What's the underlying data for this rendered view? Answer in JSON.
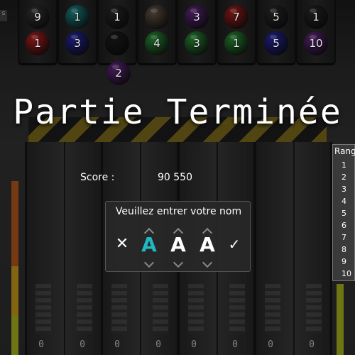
{
  "game": {
    "title": "Partie Terminée",
    "score_label": "Score :",
    "score_value": "90 550",
    "name_prompt": "Veuillez entrer votre nom",
    "name_letters": [
      "A",
      "A",
      "A"
    ],
    "active_letter_index": 0,
    "cancel_symbol": "✕",
    "confirm_symbol": "✓"
  },
  "rank_panel": {
    "header": "Rang",
    "ranks": [
      "1",
      "2",
      "3",
      "4",
      "5",
      "6",
      "7",
      "8",
      "9",
      "10"
    ]
  },
  "tubes": [
    {
      "balls": [
        {
          "label": "9",
          "color": "#3a3a3a"
        },
        {
          "label": "1",
          "color": "#c42222"
        }
      ]
    },
    {
      "balls": [
        {
          "label": "1",
          "color": "#1f8f8f"
        },
        {
          "label": "3",
          "color": "#2a2ab0"
        }
      ]
    },
    {
      "balls": [
        {
          "label": "1",
          "color": "#2b2b2b"
        },
        {
          "label": "",
          "color": "#1e1e1e"
        }
      ]
    },
    {
      "balls": [
        {
          "label": "",
          "color": "#6b5b4b"
        },
        {
          "label": "4",
          "color": "#2e9a3a"
        }
      ]
    },
    {
      "balls": [
        {
          "label": "3",
          "color": "#6a2a8a"
        },
        {
          "label": "3",
          "color": "#2e9a3a"
        }
      ]
    },
    {
      "balls": [
        {
          "label": "7",
          "color": "#b02020"
        },
        {
          "label": "1",
          "color": "#2e9a3a"
        }
      ]
    },
    {
      "balls": [
        {
          "label": "5",
          "color": "#2e2e2e"
        },
        {
          "label": "5",
          "color": "#2a2ab0"
        }
      ]
    },
    {
      "balls": [
        {
          "label": "1",
          "color": "#2a2a2a"
        },
        {
          "label": "10",
          "color": "#6a2a8a"
        }
      ]
    }
  ],
  "extra_ball": {
    "label": "2",
    "color": "#6a2a8a"
  },
  "side_labels": {
    "left_tab": "s"
  },
  "counters": [
    "0",
    "0",
    "0",
    "0",
    "0",
    "0",
    "0",
    "0"
  ]
}
